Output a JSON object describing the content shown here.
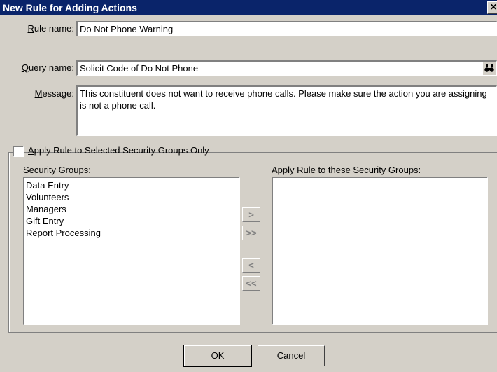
{
  "window": {
    "title": "New Rule for Adding Actions",
    "close_glyph": "✕"
  },
  "form": {
    "rule_name_label": "Rule name:",
    "rule_name_value": "Do Not Phone Warning",
    "query_name_label": "Query name:",
    "query_name_value": "Solicit Code of Do Not Phone",
    "message_label": "Message:",
    "message_value": "This constituent does not want to receive phone calls.  Please make sure the action you are assigning is not a phone call."
  },
  "security": {
    "checkbox_label": "Apply Rule to Selected Security Groups Only",
    "checked": false,
    "groups_label": "Security Groups:",
    "groups": [
      "Data Entry",
      "Volunteers",
      "Managers",
      "Gift Entry",
      "Report Processing"
    ],
    "applied_label": "Apply Rule to these Security Groups:",
    "applied_groups": []
  },
  "move_buttons": {
    "add_one": ">",
    "add_all": ">>",
    "remove_one": "<",
    "remove_all": "<<"
  },
  "buttons": {
    "ok": "OK",
    "cancel": "Cancel"
  },
  "icons": {
    "lookup": "binoculars-icon"
  }
}
